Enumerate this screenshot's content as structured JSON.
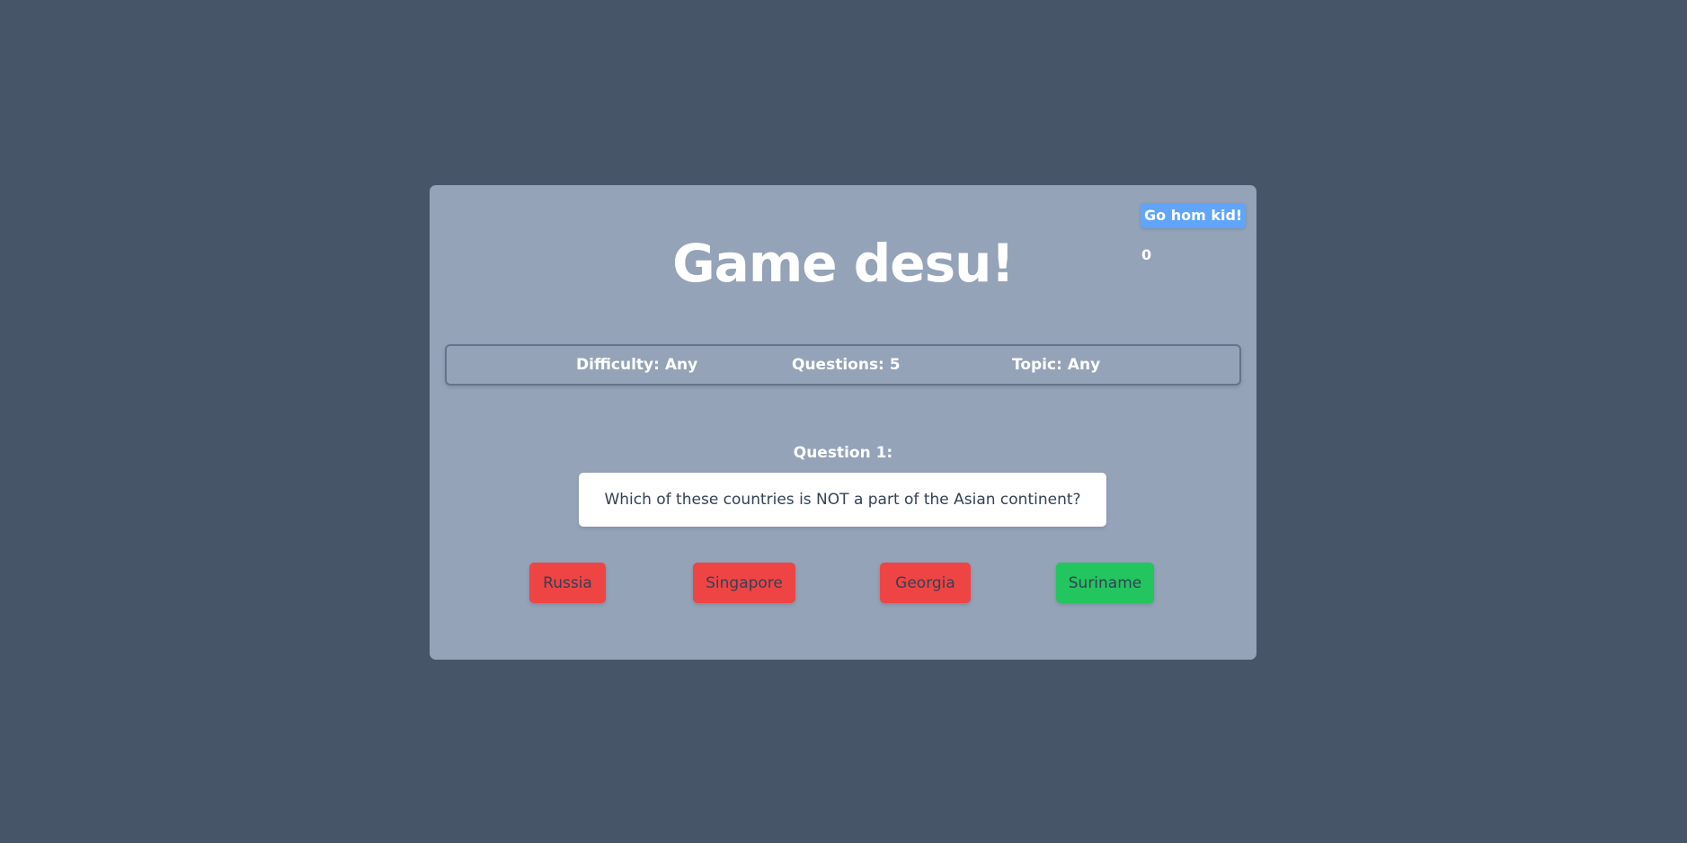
{
  "header": {
    "title": "Game desu!",
    "home_button_label": "Go hom kid!",
    "score": "0"
  },
  "settings": {
    "difficulty": "Difficulty: Any",
    "questions": "Questions: 5",
    "topic": "Topic: Any"
  },
  "question": {
    "label": "Question 1:",
    "text": "Which of these countries is NOT a part of the Asian continent?"
  },
  "answers": [
    {
      "label": "Russia",
      "color": "#ef4444"
    },
    {
      "label": "Singapore",
      "color": "#ef4444"
    },
    {
      "label": "Georgia",
      "color": "#ef4444"
    },
    {
      "label": "Suriname",
      "color": "#22c55e"
    }
  ],
  "colors": {
    "page_background": "#475569",
    "card_background": "#94a3b8",
    "home_button": "#60a5fa",
    "wrong_answer": "#ef4444",
    "correct_answer": "#22c55e"
  }
}
